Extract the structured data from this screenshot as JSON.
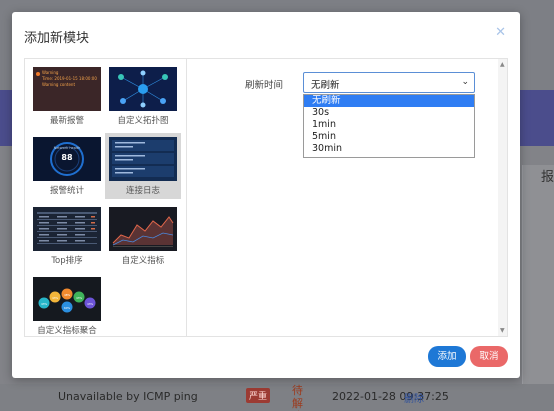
{
  "background": {
    "right_label": "报",
    "row": {
      "host": "Unavailable by ICMP ping",
      "severity": "严重",
      "status": "待解决",
      "time": "2022-01-28 09:37:25",
      "link": "删除"
    }
  },
  "modal": {
    "title": "添加新模块",
    "close_icon": "close-icon",
    "modules": [
      {
        "label": "最新报警",
        "thumb": "latest-alarm-thumb"
      },
      {
        "label": "自定义拓扑图",
        "thumb": "topology-thumb"
      },
      {
        "label": "报警统计",
        "thumb": "alarm-stats-thumb"
      },
      {
        "label": "连接日志",
        "thumb": "connection-log-thumb",
        "selected": true
      },
      {
        "label": "Top排序",
        "thumb": "top-sort-thumb"
      },
      {
        "label": "自定义指标",
        "thumb": "custom-metric-thumb"
      },
      {
        "label": "自定义指标聚合",
        "thumb": "metric-aggregate-thumb"
      }
    ],
    "thumb_text": {
      "alarm_line1": "Warning",
      "alarm_line2": "Time: 2019-01-15 18:00:00",
      "alarm_line3": "Warning content",
      "gauge_title": "Network health",
      "gauge_value": "88",
      "pie_values": [
        "43%",
        "43%",
        "48%",
        "43%",
        "43%",
        "60%"
      ]
    },
    "refresh": {
      "label": "刷新时间",
      "selected": "无刷新",
      "options": [
        "无刷新",
        "30s",
        "1min",
        "5min",
        "30min"
      ]
    },
    "buttons": {
      "add": "添加",
      "cancel": "取消"
    }
  },
  "colors": {
    "primary": "#1e78d6",
    "danger": "#ea6868",
    "option_highlight": "#2f7df3",
    "backdrop": "#7d7f85"
  }
}
